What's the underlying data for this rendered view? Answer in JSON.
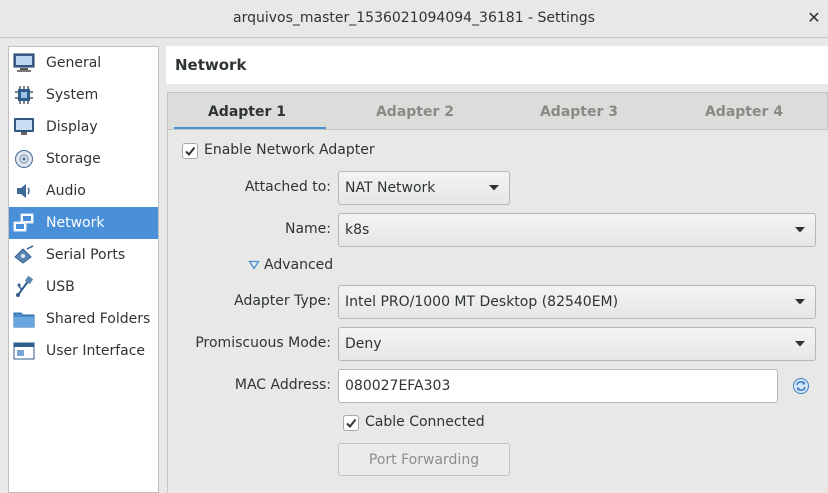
{
  "window": {
    "title": "arquivos_master_1536021094094_36181 - Settings",
    "close_glyph": "✕"
  },
  "sidebar": {
    "items": [
      {
        "label": "General",
        "icon": "general-icon"
      },
      {
        "label": "System",
        "icon": "system-icon"
      },
      {
        "label": "Display",
        "icon": "display-icon"
      },
      {
        "label": "Storage",
        "icon": "storage-icon"
      },
      {
        "label": "Audio",
        "icon": "audio-icon"
      },
      {
        "label": "Network",
        "icon": "network-icon",
        "selected": true
      },
      {
        "label": "Serial Ports",
        "icon": "serial-ports-icon"
      },
      {
        "label": "USB",
        "icon": "usb-icon"
      },
      {
        "label": "Shared Folders",
        "icon": "shared-folders-icon"
      },
      {
        "label": "User Interface",
        "icon": "user-interface-icon"
      }
    ]
  },
  "page": {
    "title": "Network"
  },
  "tabs": [
    {
      "label": "Adapter 1",
      "active": true
    },
    {
      "label": "Adapter 2"
    },
    {
      "label": "Adapter 3"
    },
    {
      "label": "Adapter 4"
    }
  ],
  "adapter": {
    "enable_label": "Enable Network Adapter",
    "enable_checked": true,
    "attached_label": "Attached to:",
    "attached_value": "NAT Network",
    "name_label": "Name:",
    "name_value": "k8s",
    "advanced_label": "Advanced",
    "adapter_type_label": "Adapter Type:",
    "adapter_type_value": "Intel PRO/1000 MT Desktop (82540EM)",
    "promiscuous_label": "Promiscuous Mode:",
    "promiscuous_value": "Deny",
    "mac_label": "MAC Address:",
    "mac_value": "080027EFA303",
    "cable_label": "Cable Connected",
    "cable_checked": true,
    "port_forwarding_label": "Port Forwarding"
  },
  "colors": {
    "accent": "#4a90d9",
    "window_bg": "#e8e8e7"
  }
}
